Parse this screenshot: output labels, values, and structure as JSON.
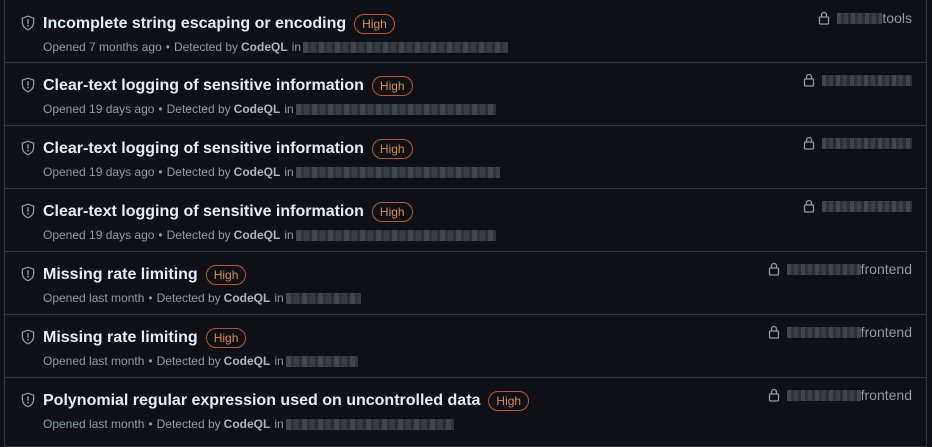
{
  "alerts": [
    {
      "title": "Incomplete string escaping or encoding",
      "severity": "High",
      "opened": "Opened 7 months ago",
      "detected_prefix": "Detected by",
      "tool": "CodeQL",
      "in_label": "in",
      "repo_name": "tools"
    },
    {
      "title": "Clear-text logging of sensitive information",
      "severity": "High",
      "opened": "Opened 19 days ago",
      "detected_prefix": "Detected by",
      "tool": "CodeQL",
      "in_label": "in",
      "repo_name": ""
    },
    {
      "title": "Clear-text logging of sensitive information",
      "severity": "High",
      "opened": "Opened 19 days ago",
      "detected_prefix": "Detected by",
      "tool": "CodeQL",
      "in_label": "in",
      "repo_name": ""
    },
    {
      "title": "Clear-text logging of sensitive information",
      "severity": "High",
      "opened": "Opened 19 days ago",
      "detected_prefix": "Detected by",
      "tool": "CodeQL",
      "in_label": "in",
      "repo_name": ""
    },
    {
      "title": "Missing rate limiting",
      "severity": "High",
      "opened": "Opened last month",
      "detected_prefix": "Detected by",
      "tool": "CodeQL",
      "in_label": "in",
      "repo_name": "frontend"
    },
    {
      "title": "Missing rate limiting",
      "severity": "High",
      "opened": "Opened last month",
      "detected_prefix": "Detected by",
      "tool": "CodeQL",
      "in_label": "in",
      "repo_name": "frontend"
    },
    {
      "title": "Polynomial regular expression used on uncontrolled data",
      "severity": "High",
      "opened": "Opened last month",
      "detected_prefix": "Detected by",
      "tool": "CodeQL",
      "in_label": "in",
      "repo_name": "frontend"
    }
  ],
  "icons": {
    "alert": "shield-icon",
    "visibility": "lock-icon"
  },
  "colors": {
    "background": "#0d1117",
    "border": "#30363d",
    "high_badge": "#db8d47",
    "muted_text": "#9198a1"
  }
}
